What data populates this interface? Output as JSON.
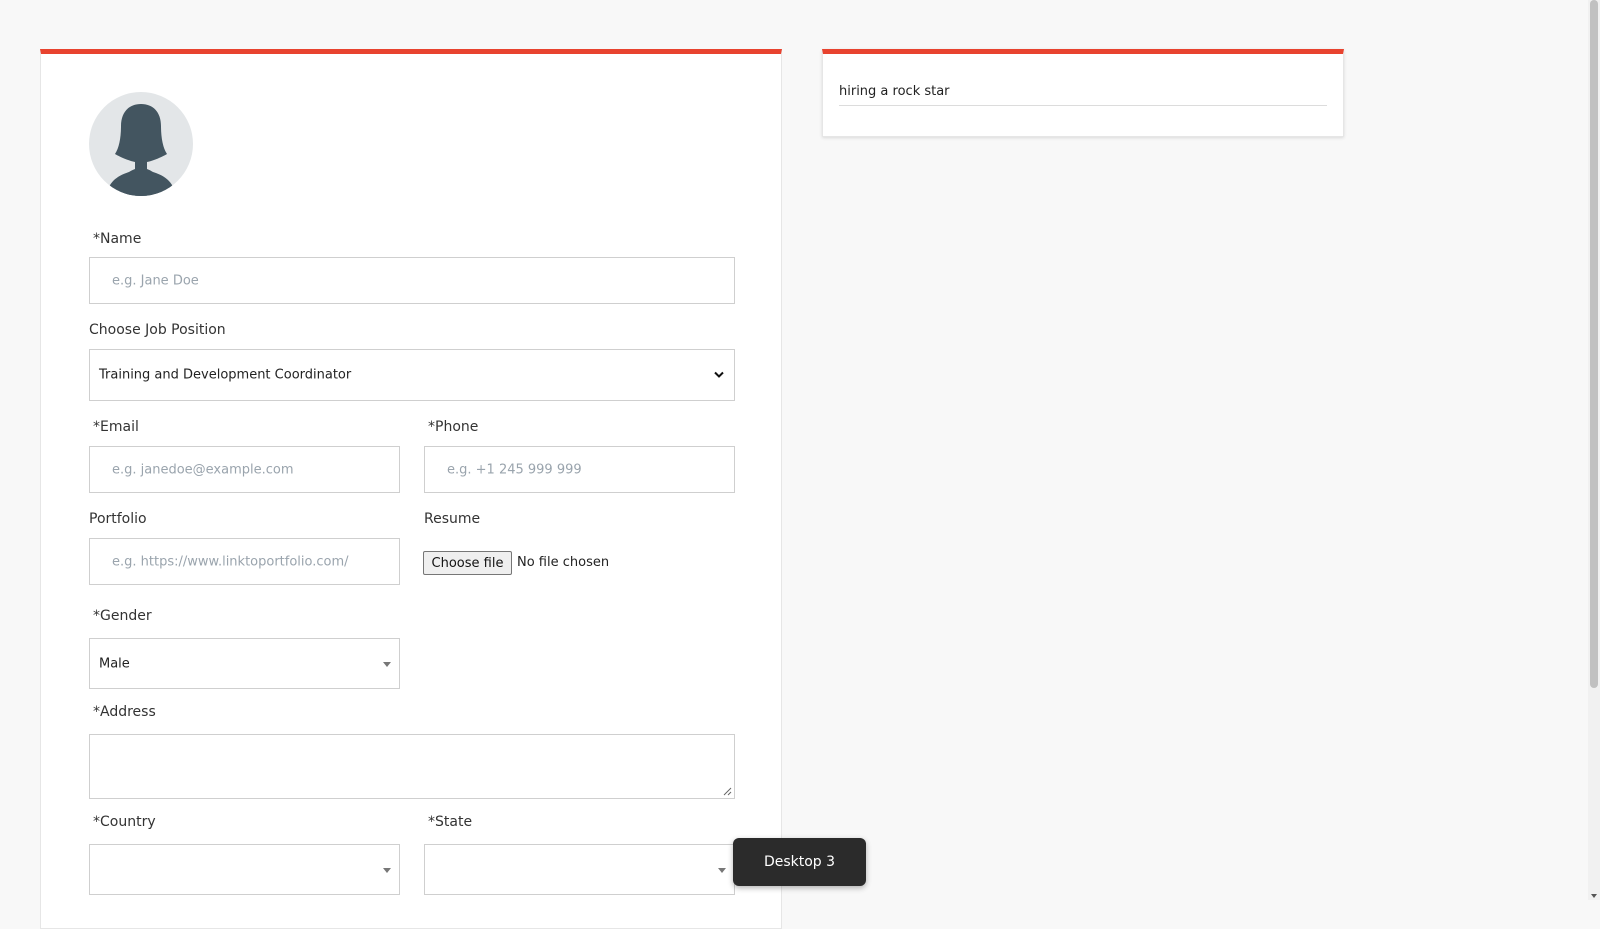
{
  "form": {
    "name": {
      "label": "*Name",
      "placeholder": "e.g. Jane Doe"
    },
    "job_position": {
      "label": "Choose Job Position",
      "selected": "Training and Development Coordinator"
    },
    "email": {
      "label": "*Email",
      "placeholder": "e.g. janedoe@example.com"
    },
    "phone": {
      "label": "*Phone",
      "placeholder": "e.g. +1 245 999 999"
    },
    "portfolio": {
      "label": "Portfolio",
      "placeholder": "e.g. https://www.linktoportfolio.com/"
    },
    "resume": {
      "label": "Resume",
      "button_label": "Choose file",
      "status": "No file chosen"
    },
    "gender": {
      "label": "*Gender",
      "selected": "Male"
    },
    "address": {
      "label": "*Address",
      "value": ""
    },
    "country": {
      "label": "*Country",
      "selected": ""
    },
    "state": {
      "label": "*State",
      "selected": ""
    }
  },
  "sidebar": {
    "text": "hiring a rock star"
  },
  "tooltip": {
    "text": "Desktop 3"
  },
  "colors": {
    "accent": "#e8432f",
    "avatar_bg": "#e3e6e8",
    "avatar_fg": "#435560"
  },
  "icons": {
    "avatar": "female-avatar-icon",
    "dropdown": "chevron-down-icon",
    "caret": "caret-down-icon"
  }
}
